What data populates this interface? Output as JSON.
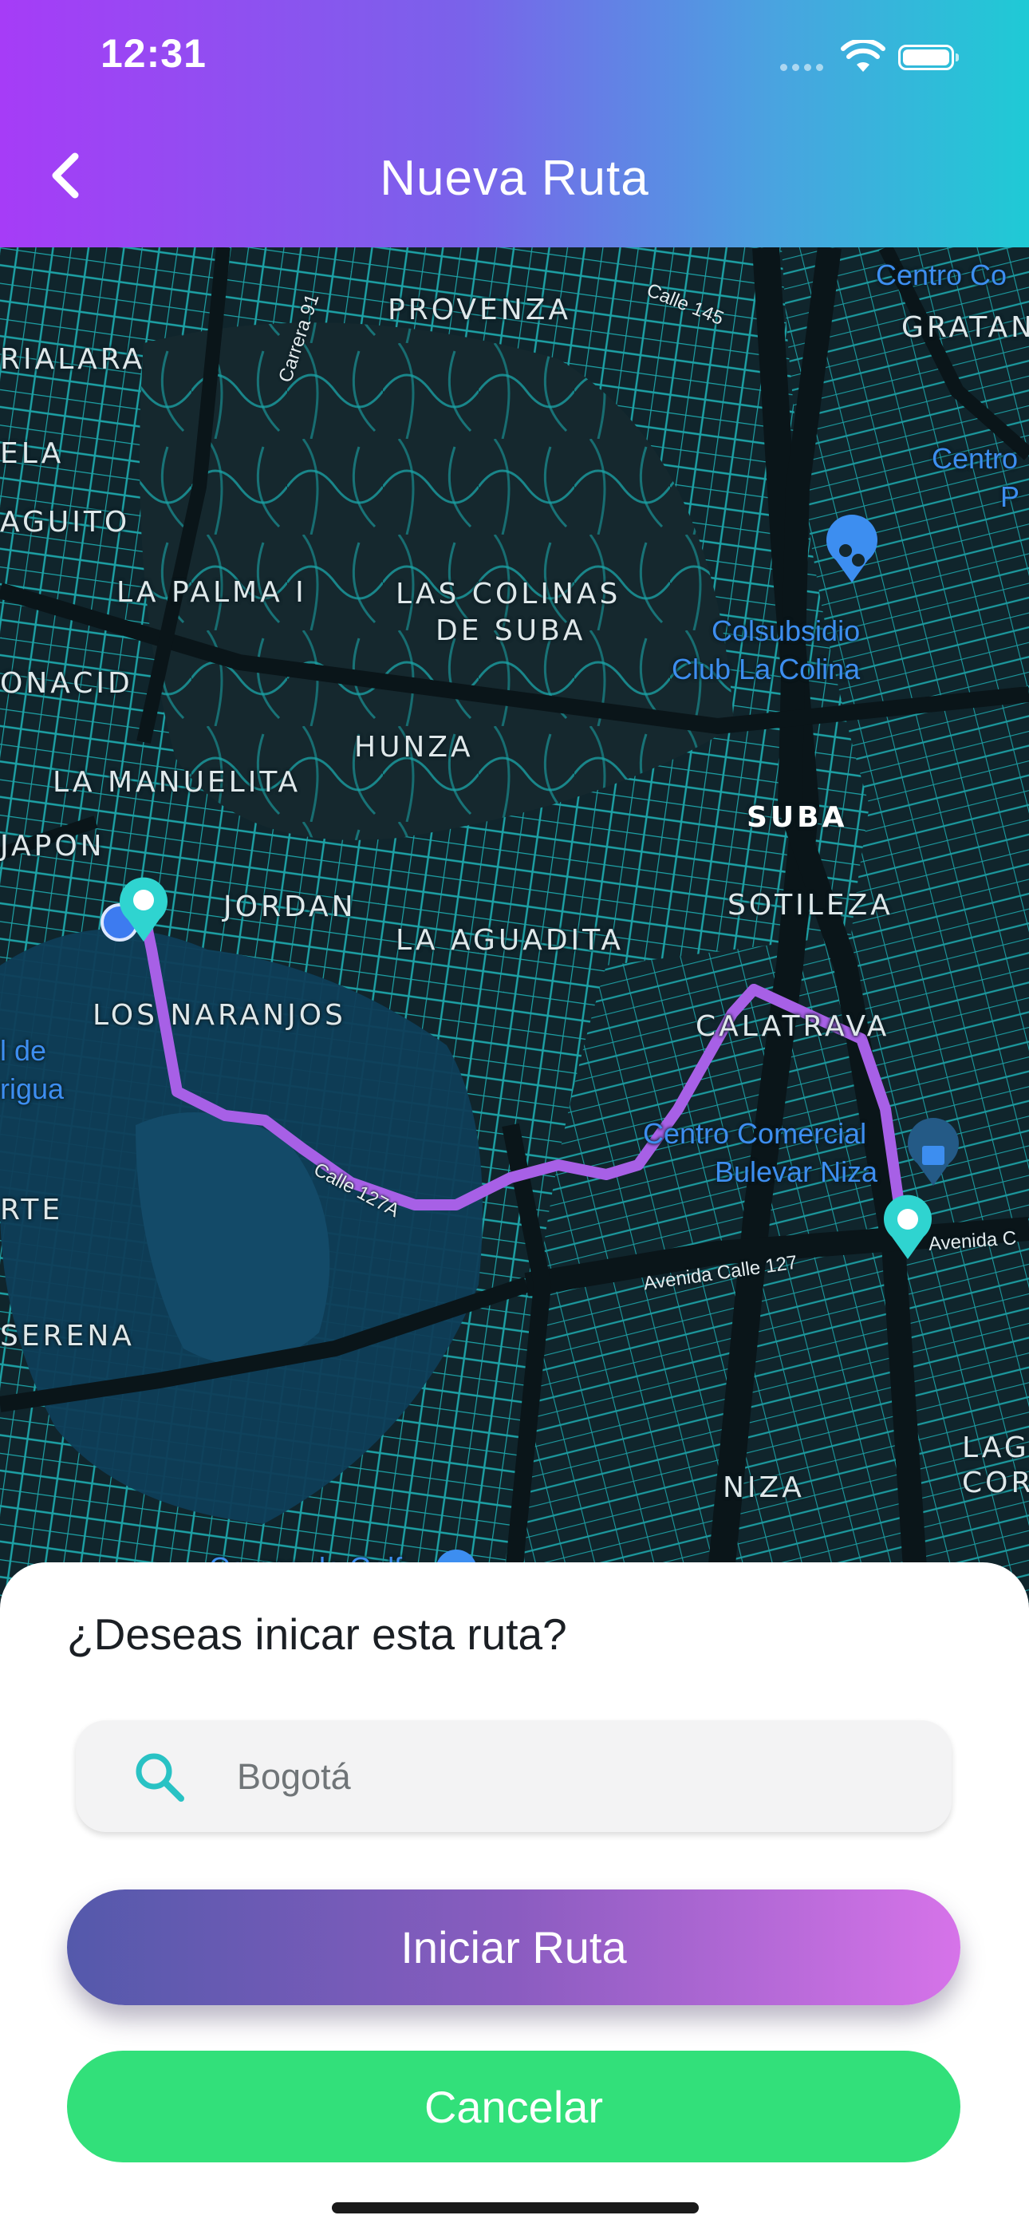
{
  "status_bar": {
    "time": "12:31"
  },
  "header": {
    "title": "Nueva Ruta"
  },
  "map": {
    "neighborhoods": [
      "PROVENZA",
      "RIALARA",
      "ELA",
      "AGUITO",
      "LA PALMA I",
      "LAS COLINAS",
      "DE SUBA",
      "ONACID",
      "LA MANUELITA",
      "HUNZA",
      "JAPON",
      "JORDAN",
      "LA AGUADITA",
      "LOS NARANJOS",
      "SUBA",
      "SOTILEZA",
      "CALATRAVA",
      "RTE",
      "SERENA",
      "NIZA",
      "GRATAN",
      "LAG",
      "COR"
    ],
    "places": [
      "Colsubsidio",
      "Club La Colina",
      "Centro Comercial",
      "Bulevar Niza",
      "Centro Co",
      "Centro",
      "P",
      "l de",
      "rigua",
      "Campo de Golf"
    ],
    "streets": [
      "Calle 145",
      "Carrera 91",
      "Calle 127A",
      "Avenida Calle 127",
      "Avenida C"
    ],
    "route_color": "#a760e6",
    "marker_color": "#2fd4d0"
  },
  "sheet": {
    "question": "¿Deseas inicar esta ruta?",
    "search_value": "Bogotá",
    "start_label": "Iniciar Ruta",
    "cancel_label": "Cancelar"
  }
}
